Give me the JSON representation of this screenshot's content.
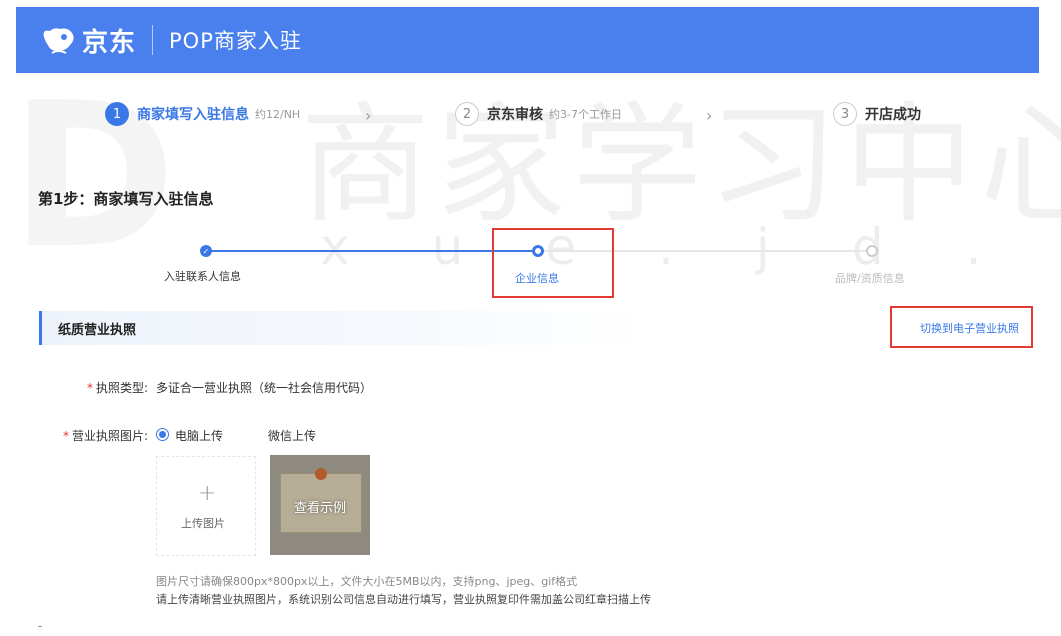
{
  "header": {
    "brand": "京东",
    "portal_title": "POP商家入驻"
  },
  "steps": [
    {
      "num": "1",
      "label": "商家填写入驻信息",
      "hint": "约12/NH",
      "state": "active"
    },
    {
      "num": "2",
      "label": "京东审核",
      "hint": "约3-7个工作日",
      "state": "pending"
    },
    {
      "num": "3",
      "label": "开店成功",
      "hint": "",
      "state": "pending"
    }
  ],
  "section_title": "第1步：商家填写入驻信息",
  "sub_steps": [
    {
      "label": "入驻联系人信息",
      "state": "done"
    },
    {
      "label": "企业信息",
      "state": "current"
    },
    {
      "label": "品牌/资质信息",
      "state": "todo"
    }
  ],
  "license": {
    "title": "纸质营业执照",
    "switch_link": "切换到电子营业执照"
  },
  "form": {
    "license_type_label": "执照类型:",
    "license_type_value": "多证合一营业执照（统一社会信用代码）",
    "license_image_label": "营业执照图片:",
    "upload_option_pc": "电脑上传",
    "upload_option_wechat": "微信上传",
    "upload_button": "上传图片",
    "sample_label": "查看示例",
    "hint_size": "图片尺寸请确保800px*800px以上，文件大小在5MB以内，支持png、jpeg、gif格式",
    "hint_upload": "请上传清晰营业执照图片，系统识别公司信息自动进行填写，营业执照复印件需加盖公司红章扫描上传"
  },
  "watermark": {
    "cn": "商家学习中心",
    "en": "xue.jd.co"
  },
  "colors": {
    "header_bg": "#4a7fee",
    "accent": "#3b78e7",
    "highlight": "#e53935"
  }
}
